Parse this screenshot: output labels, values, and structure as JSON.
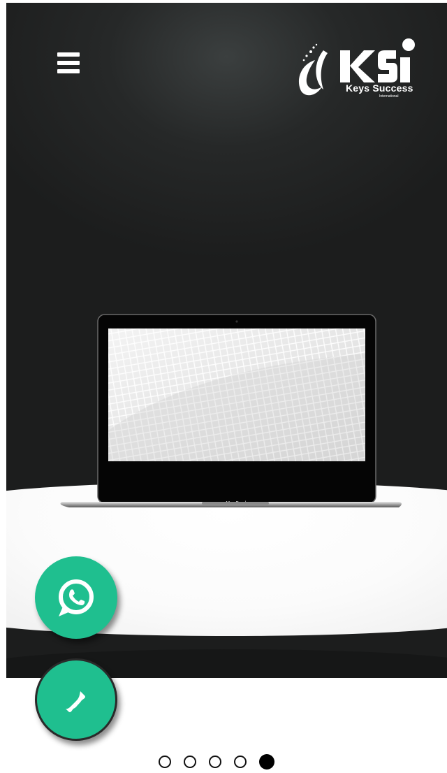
{
  "header": {
    "menu_icon": "hamburger-menu-icon",
    "logo": {
      "letters": "KSI",
      "tagline": "Keys Success",
      "subtagline": "International"
    }
  },
  "hero": {
    "slide_image": "laptop-product-mockup",
    "laptop_badge": "MacBook"
  },
  "floating_actions": [
    {
      "name": "whatsapp",
      "icon": "whatsapp-icon",
      "color": "#1fbf8f"
    },
    {
      "name": "call",
      "icon": "phone-icon",
      "color": "#1fbf8f"
    }
  ],
  "carousel": {
    "slide_count": 5,
    "active_index": 4
  }
}
